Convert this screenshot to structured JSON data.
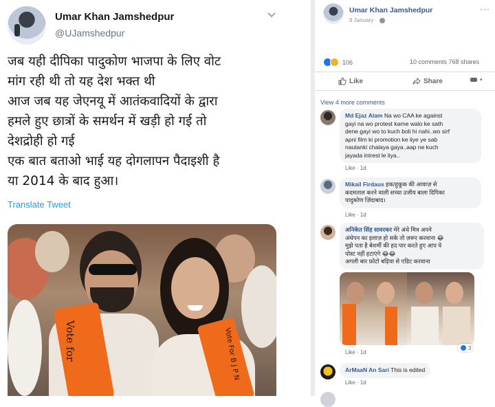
{
  "tweet": {
    "name": "Umar Khan Jamshedpur",
    "handle": "@UJamshedpur",
    "lines": [
      "जब यही दीपिका पादुकोण भाजपा के लिए वोट",
      "मांग रही थी तो यह देश भक्त थी",
      "आज जब यह जेएनयू में आतंकवादियों के द्वारा",
      "हमले हुए छात्रों के समर्थन में खड़ी हो गई तो",
      "देशद्रोही हो गई",
      "एक बात बताओ भाई यह दोगलापन पैदाइशी है",
      "या 2014 के बाद हुआ।"
    ],
    "translate": "Translate Tweet",
    "photo": {
      "scarf_text_left": "Vote for",
      "scarf_text_right": "Vote For B J P N"
    }
  },
  "facebook": {
    "name": "Umar Khan Jamshedpur",
    "date": "8 January ·",
    "reaction_count": "106",
    "counts": "10 comments  768 shares",
    "actions": {
      "like": "Like",
      "share": "Share"
    },
    "view_more": "View 4 more comments",
    "comments": [
      {
        "name": "Md Ejaz Alam",
        "text": [
          " Na wo CAA ke against",
          "gayi na wo protest karne walo ke sath",
          "dene gayi wo to kuch boli hi nahi..wo sirf",
          "apni film ki promotion ke liye ye sab",
          "nautanki chalaya gaya..aap ne kuch",
          "jayada intrest le liya.."
        ],
        "like": "Like · 1d"
      },
      {
        "name": "Mikail Firdaus",
        "text": [
          " हक/हुकूक की आवाज़ से",
          "कदमताल करने वाली सच्चा उजीय बाला दिपिका",
          "पादुकोण ज़िंदाबाद।"
        ],
        "like": "Like · 1d"
      },
      {
        "name": "अनिकेत सिंह सावरकर",
        "text": [
          " मेरे अंधे मित्र अपने",
          "अंधेपन का इलाज़ हो सके तो ज़रूर करवाना 😂",
          "मुझे पता है बेशर्मी की हद पार करते हुए आप ये",
          "पोस्ट नहीं हटाएंगे 😂😂",
          "अगली बार फ़ोटो बढ़िया से एडिट करवाना"
        ],
        "like": "Like · 1d",
        "photo_react": "3"
      },
      {
        "name": "ArMaaN An Sari",
        "text": [
          " This is edited"
        ],
        "like": "Like · 1d"
      }
    ]
  },
  "colors": {
    "fb_blue": "#385898",
    "twitter_blue": "#1da1f2",
    "saffron": "#f06a1c"
  }
}
